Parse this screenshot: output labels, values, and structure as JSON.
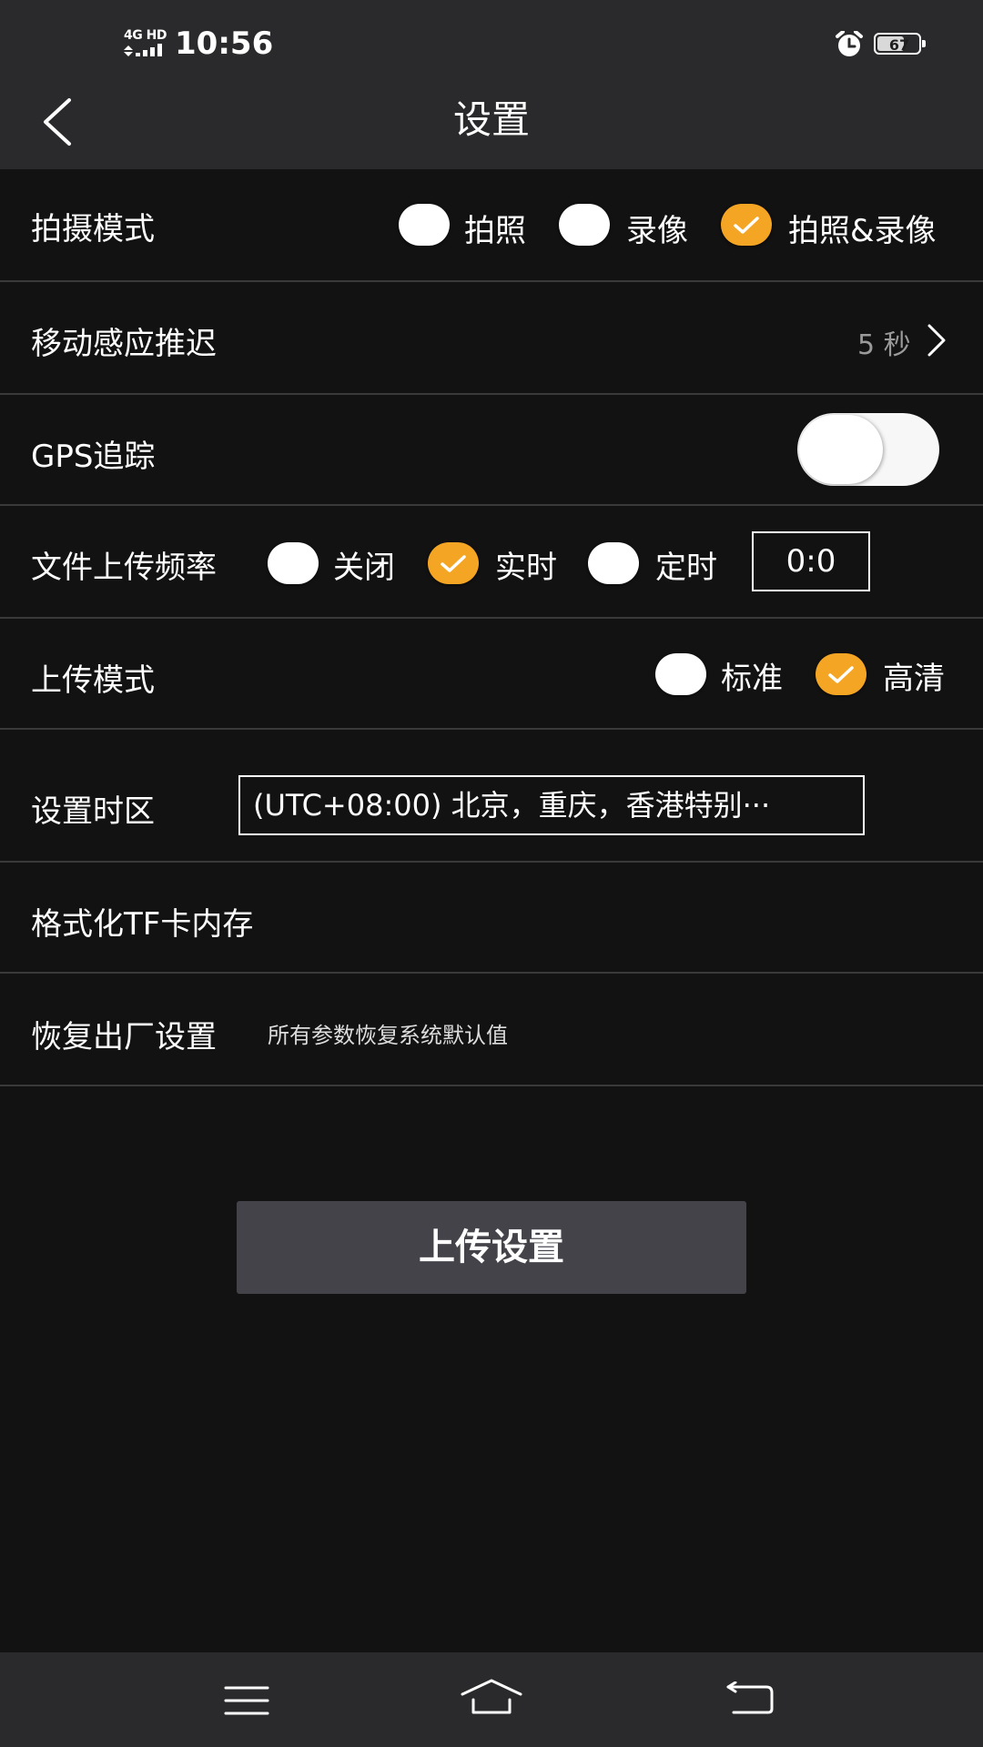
{
  "status_bar": {
    "network": "4G HD",
    "time": "10:56",
    "battery": "67",
    "battery_level_percent": 67
  },
  "header": {
    "title": "设置",
    "back_icon": "chevron-left-icon"
  },
  "settings": {
    "capture_mode": {
      "label": "拍摄模式",
      "options": [
        "拍照",
        "录像",
        "拍照&录像"
      ],
      "selected": "拍照&录像"
    },
    "motion_delay": {
      "label": "移动感应推迟",
      "value": "5 秒"
    },
    "gps": {
      "label": "GPS追踪",
      "enabled": false
    },
    "upload_frequency": {
      "label": "文件上传频率",
      "options": [
        "关闭",
        "实时",
        "定时"
      ],
      "selected": "实时",
      "timer_value": "0:0"
    },
    "upload_mode": {
      "label": "上传模式",
      "options": [
        "标准",
        "高清"
      ],
      "selected": "高清"
    },
    "timezone": {
      "label": "设置时区",
      "value": "(UTC+08:00) 北京，重庆，香港特别···"
    },
    "format_tf": {
      "label": "格式化TF卡内存"
    },
    "factory_reset": {
      "label": "恢复出厂设置",
      "hint": "所有参数恢复系统默认值"
    }
  },
  "upload_button": {
    "label": "上传设置"
  },
  "colors": {
    "accent": "#f5a524",
    "background": "#121212",
    "header": "#2a2a2c",
    "button": "#434349",
    "divider": "#3a3a3a"
  },
  "nav_icons": [
    "menu-icon",
    "home-icon",
    "back-icon"
  ]
}
